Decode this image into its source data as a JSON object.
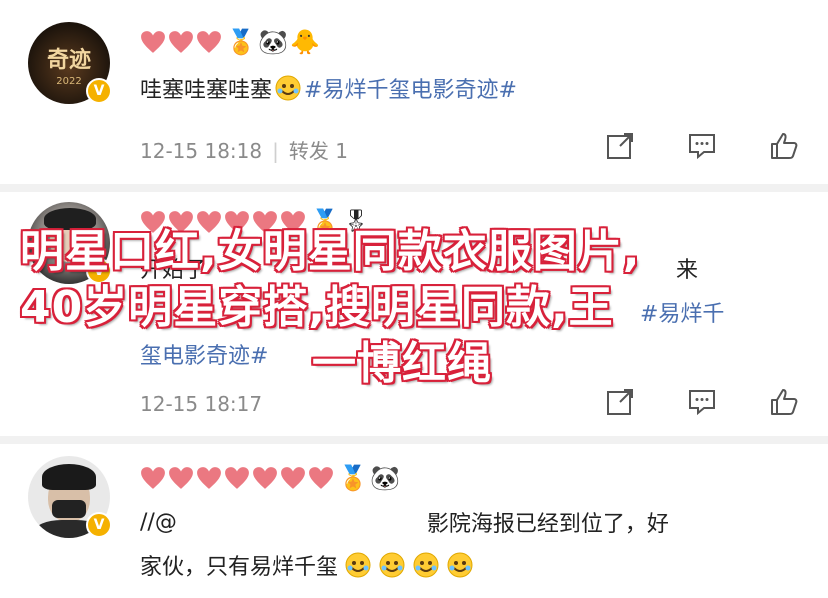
{
  "posts": [
    {
      "avatar_badge": "V",
      "avatar_caption": "奇迹",
      "avatar_sub": "2022",
      "text_plain": "哇塞哇塞哇塞",
      "topic": "#易烊千玺电影奇迹#",
      "time": "12-15 18:18",
      "repost": "转发 1"
    },
    {
      "avatar_badge": "V",
      "text_line1_a": "开始了",
      "text_line1_b": "来",
      "text_line1_topic": "#易烊千",
      "text_line2_topic": "玺电影奇迹#",
      "time": "12-15 18:17"
    },
    {
      "avatar_badge": "V",
      "text_line1_a": "//@",
      "text_line1_b": "影院海报已经到位了，好",
      "text_line2": "家伙，只有易烊千玺"
    }
  ],
  "overlay": {
    "line1": "明星口红,女明星同款衣服图片,",
    "line2": "40岁明星穿搭,搜明星同款,王",
    "line3": "一博红绳"
  },
  "icons": {
    "share": "share-icon",
    "comment": "comment-icon",
    "like": "like-icon",
    "emoji": "smile-face-icon"
  },
  "colors": {
    "topic": "#4a6fb0",
    "overlay_stroke": "#d8213a",
    "verified": "#f5b100"
  }
}
